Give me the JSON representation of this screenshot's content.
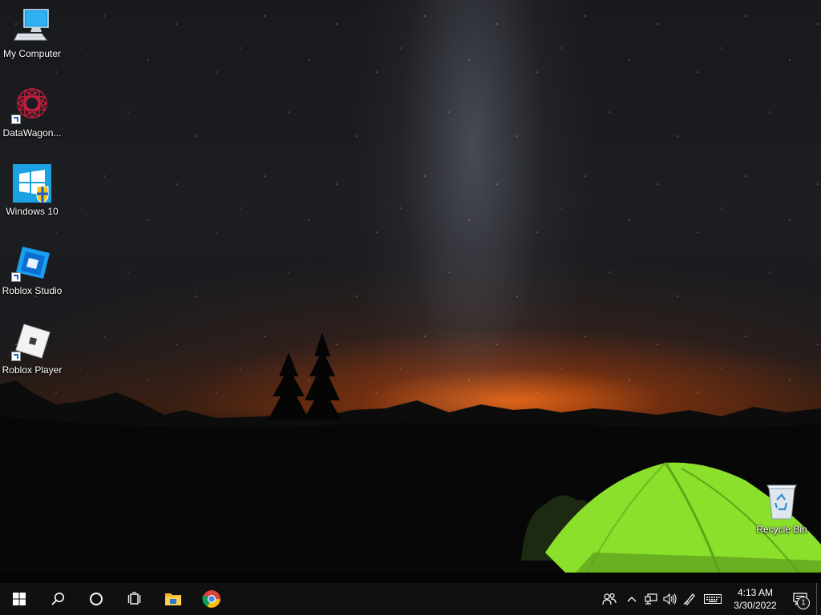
{
  "desktop": {
    "icons": [
      {
        "label": "My Computer"
      },
      {
        "label": "DataWagon..."
      },
      {
        "label": "Windows 10"
      },
      {
        "label": "Roblox Studio"
      },
      {
        "label": "Roblox Player"
      },
      {
        "label": "Recycle Bin"
      }
    ]
  },
  "taskbar": {
    "start_icon": "windows-logo-icon",
    "search_icon": "search-icon",
    "cortana_icon": "cortana-circle-icon",
    "task_view_icon": "task-view-icon",
    "pinned": [
      "file-explorer-icon",
      "chrome-icon"
    ],
    "tray": {
      "icons": [
        "people-icon",
        "chevron-up-icon",
        "network-icon",
        "volume-icon",
        "pen-icon",
        "keyboard-icon"
      ],
      "time": "4:13 AM",
      "date": "3/30/2022",
      "notification_count": "1"
    }
  },
  "colors": {
    "taskbar_bg": "#101010",
    "tent_green": "#8be02c",
    "horizon_orange": "#ff6e14",
    "windows_blue": "#1ba1e2"
  }
}
